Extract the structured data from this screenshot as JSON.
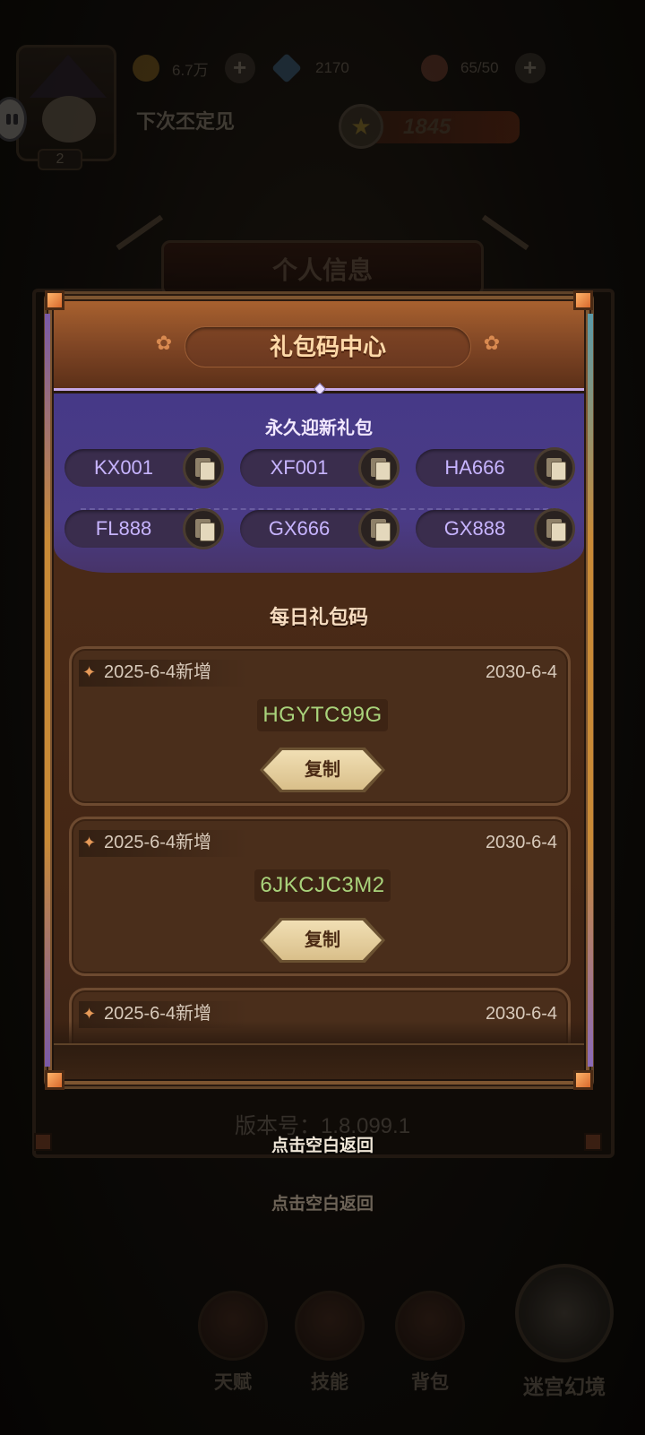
{
  "hud": {
    "gold": "6.7万",
    "gems": "2170",
    "stamina": "65/50",
    "plus_label": "+",
    "player_name": "下次丕定见",
    "player_level": "2",
    "power_icon": "★",
    "power": "1845"
  },
  "under_title": "个人信息",
  "modal": {
    "title": "礼包码中心",
    "star_icon": "✿",
    "permanent_title": "永久迎新礼包",
    "permanent_codes": [
      "KX001",
      "XF001",
      "HA666",
      "FL888",
      "GX666",
      "GX888"
    ],
    "daily_title": "每日礼包码",
    "spark_icon": "✦",
    "copy_label": "复制",
    "daily_codes": [
      {
        "added": "2025-6-4新增",
        "expire": "2030-6-4",
        "code": "HGYTC99G"
      },
      {
        "added": "2025-6-4新增",
        "expire": "2030-6-4",
        "code": "6JKCJC3M2"
      },
      {
        "added": "2025-6-4新增",
        "expire": "2030-6-4",
        "code": ""
      }
    ]
  },
  "version": "版本号：1.8.099.1",
  "tap_back_label": "点击空白返回",
  "nav": {
    "talent": "天赋",
    "skill": "技能",
    "bag": "背包",
    "maze": "迷宫幻境"
  },
  "colors": {
    "header": "#a8612f",
    "permanent_section": "#463987",
    "code_text": "#c7b4ff",
    "daily_code_text": "#a9d37b",
    "copy_button": "#e4cf9f"
  }
}
